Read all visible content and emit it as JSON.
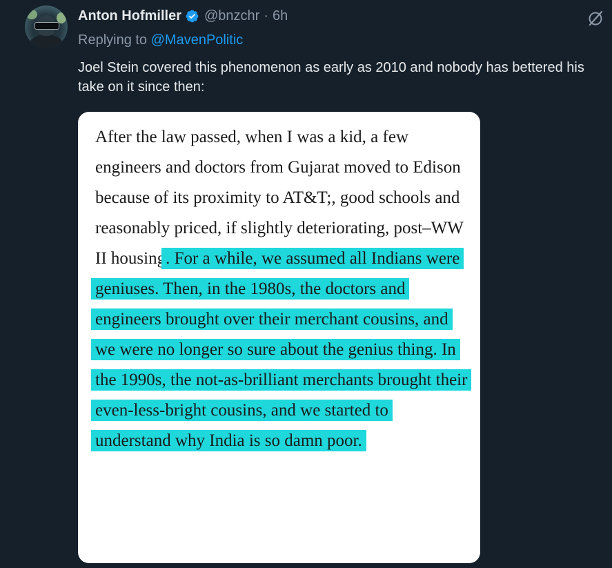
{
  "tweet": {
    "author_name": "Anton Hofmiller",
    "handle": "@bnzchr",
    "separator": "·",
    "time": "6h",
    "replying_prefix": "Replying to",
    "replying_to": "@MavenPolitic",
    "text": "Joel Stein covered this phenomenon as early as 2010 and nobody has bettered his take on it since then:",
    "verified_color": "#1d9bf0",
    "icons": [
      "verified-badge-icon",
      "edit-icon"
    ]
  },
  "media": {
    "plain_text": "After the law passed, when I was a kid, a few engineers and doctors from Gujarat moved to Edison because of its proximity to AT&T;, good schools and reasonably priced, if slightly deteriorating, post–WW II housing",
    "highlighted_text": ". For a while, we assumed all Indians were geniuses. Then, in the 1980s, the doctors and engineers brought over their merchant cousins, and we were no longer so sure about the genius thing. In the 1990s, the not-as-brilliant merchants brought their even-less-bright cousins, and we started to understand why India is so damn poor.",
    "highlight_color": "#1fd8dc"
  }
}
